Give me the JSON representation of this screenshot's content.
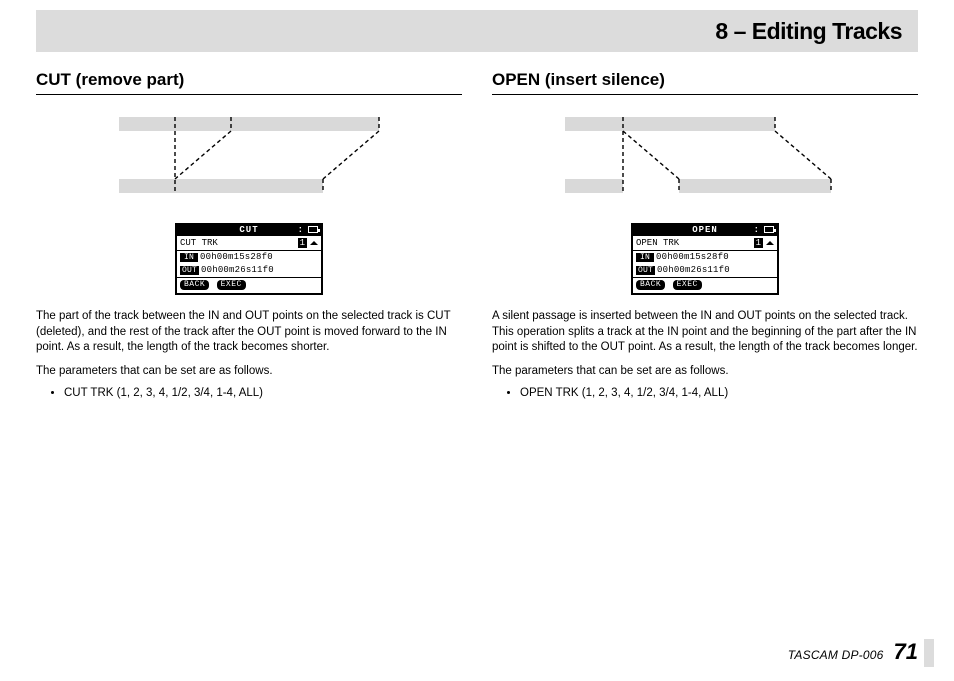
{
  "header": {
    "chapter": "8 – Editing Tracks"
  },
  "left": {
    "heading": "CUT (remove part)",
    "lcd": {
      "title": "CUT",
      "row1_label": "CUT TRK",
      "row1_value": "1",
      "in_label": "IN",
      "in_value": "00h00m15s28f0",
      "out_label": "OUT",
      "out_value": "00h00m26s11f0",
      "btn_back": "BACK",
      "btn_exec": "EXEC"
    },
    "para1": "The part of the track between the IN and OUT points on the selected track is CUT (deleted), and the rest of the track after the OUT point is moved forward to the IN point. As a result, the length of the track becomes shorter.",
    "para2": "The parameters that can be set are as follows.",
    "bullet1": "CUT TRK (1, 2, 3, 4, 1/2, 3/4, 1-4, ALL)"
  },
  "right": {
    "heading": "OPEN (insert silence)",
    "lcd": {
      "title": "OPEN",
      "row1_label": "OPEN TRK",
      "row1_value": "1",
      "in_label": "IN",
      "in_value": "00h00m15s28f0",
      "out_label": "OUT",
      "out_value": "00h00m26s11f0",
      "btn_back": "BACK",
      "btn_exec": "EXEC"
    },
    "para1": "A silent passage is inserted between the IN and OUT points on the selected track. This operation splits a track at the IN point and the beginning of the part after the IN point is shifted to the OUT point. As a result, the length of the track becomes longer.",
    "para2": "The parameters that can be set are as follows.",
    "bullet1": "OPEN TRK (1, 2, 3, 4, 1/2, 3/4, 1-4, ALL)"
  },
  "footer": {
    "model": "TASCAM  DP-006",
    "page": "71"
  }
}
